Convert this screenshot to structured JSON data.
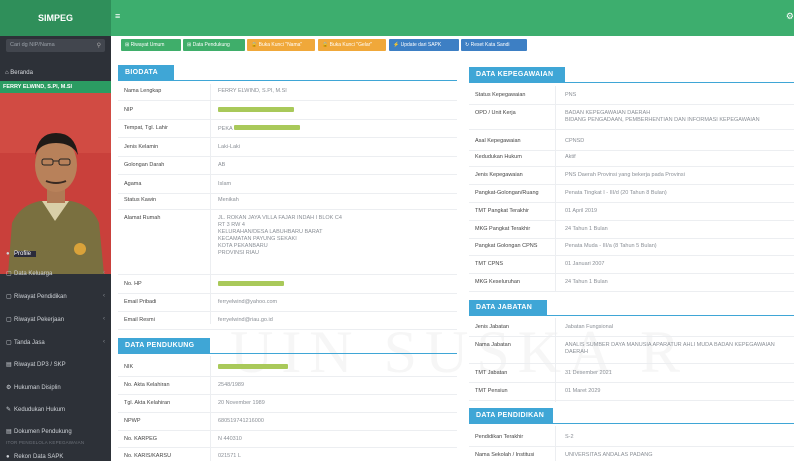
{
  "app": {
    "brand": "SIMPEG",
    "menu_icon": "≡",
    "top_right": "⚙"
  },
  "sidebar": {
    "search_placeholder": "Cari dg NIP/Nama",
    "home": "Beranda",
    "user_name": "FERRY ELWIND, S.PI, M.SI",
    "items": [
      {
        "label": "Profile",
        "icon": "●",
        "chevron": ""
      },
      {
        "label": "Data Keluarga",
        "icon": "▢",
        "chevron": "‹"
      },
      {
        "label": "Riwayat Pendidikan",
        "icon": "▢",
        "chevron": "‹"
      },
      {
        "label": "Riwayat Pekerjaan",
        "icon": "▢",
        "chevron": "‹"
      },
      {
        "label": "Tanda Jasa",
        "icon": "▢",
        "chevron": "‹"
      },
      {
        "label": "Riwayat DP3 / SKP",
        "icon": "▤",
        "chevron": ""
      },
      {
        "label": "Hukuman Disiplin",
        "icon": "⚙",
        "chevron": ""
      },
      {
        "label": "Kedudukan Hukum",
        "icon": "✎",
        "chevron": ""
      },
      {
        "label": "Dokumen Pendukung",
        "icon": "▤",
        "chevron": ""
      }
    ],
    "caption": "ITOR PENGELOLA KEPEGAWAIAN",
    "bottom_item": "Rekon Data SAPK"
  },
  "toolbar": {
    "b1": "⊞ Riwayat Umum",
    "b2": "⊞ Data Pendukung",
    "b3": "🔒 Buka Kunci \"Nama\"",
    "b4": "🔒 Buka Kunci \"Gelar\"",
    "b5": "⚡ Update dari SAPK",
    "b6": "↻ Reset Kata Sandi"
  },
  "biodata": {
    "title": "BIODATA",
    "rows": [
      {
        "label": "Nama Lengkap",
        "value": "FERRY ELWIND, S.PI, M.SI"
      },
      {
        "label": "NIP",
        "value": ""
      },
      {
        "label": "Tempat, Tgl. Lahir",
        "value": "PEKA"
      },
      {
        "label": "Jenis Kelamin",
        "value": "Laki-Laki"
      },
      {
        "label": "Golongan Darah",
        "value": "AB"
      },
      {
        "label": "Agama",
        "value": "Islam"
      },
      {
        "label": "Status Kawin",
        "value": "Menikah"
      }
    ],
    "alamat_label": "Alamat Rumah",
    "alamat_lines": [
      "JL. ROKAN JAYA VILLA FAJAR INDAH I BLOK C4",
      "RT 3 RW 4",
      "KELURAHAN/DESA LABUHBARU BARAT",
      "KECAMATAN PAYUNG SEKAKI",
      "KOTA PEKANBARU",
      "PROVINSI RIAU"
    ],
    "hp_label": "No. HP",
    "email_pribadi_label": "Email Pribadi",
    "email_pribadi": "ferryelwind@yahoo.com",
    "email_resmi_label": "Email Resmi",
    "email_resmi": "ferryelwind@riau.go.id"
  },
  "pendukung": {
    "title": "DATA PENDUKUNG",
    "rows": [
      {
        "label": "NIK",
        "value": ""
      },
      {
        "label": "No. Akta Kelahiran",
        "value": "2548/1989"
      },
      {
        "label": "Tgl. Akta Kelahiran",
        "value": "20 November 1989"
      },
      {
        "label": "NPWP",
        "value": "680519741216000"
      },
      {
        "label": "No. KARPEG",
        "value": "N 440310"
      },
      {
        "label": "No. KARIS/KARSU",
        "value": "021571 L"
      }
    ]
  },
  "kepegawaian": {
    "title": "DATA KEPEGAWAIAN",
    "rows": [
      {
        "label": "Status Kepegawaian",
        "value": "PNS",
        "value2": ""
      },
      {
        "label": "OPD / Unit Kerja",
        "value": "BADAN KEPEGAWAIAN DAERAH",
        "value2": "BIDANG PENGADAAN, PEMBERHENTIAN DAN INFORMASI KEPEGAWAIAN"
      },
      {
        "label": "Asal Kepegawaian",
        "value": "CPNSD",
        "value2": ""
      },
      {
        "label": "Kedudukan Hukum",
        "value": "Aktif",
        "value2": ""
      },
      {
        "label": "Jenis Kepegawaian",
        "value": "PNS Daerah Provinsi yang bekerja pada Provinsi",
        "value2": ""
      },
      {
        "label": "Pangkat-Golongan/Ruang",
        "value": "Penata Tingkat I - III/d (20 Tahun 8 Bulan)",
        "value2": ""
      },
      {
        "label": "TMT Pangkat Terakhir",
        "value": "01 April 2019",
        "value2": ""
      },
      {
        "label": "MKG Pangkat Terakhir",
        "value": "24 Tahun 1 Bulan",
        "value2": ""
      },
      {
        "label": "Pangkat Golongan CPNS",
        "value": "Penata Muda - III/a (8 Tahun 5 Bulan)",
        "value2": ""
      },
      {
        "label": "TMT CPNS",
        "value": "01 Januari 2007",
        "value2": ""
      },
      {
        "label": "MKG Keseluruhan",
        "value": "24 Tahun 1 Bulan",
        "value2": ""
      }
    ]
  },
  "jabatan": {
    "title": "DATA JABATAN",
    "rows": [
      {
        "label": "Jenis Jabatan",
        "value": "Jabatan Fungsional",
        "value2": ""
      },
      {
        "label": "Nama Jabatan",
        "value": "ANALIS SUMBER DAYA MANUSIA APARATUR AHLI MUDA BADAN KEPEGAWAIAN",
        "value2": "DAERAH"
      },
      {
        "label": "TMT Jabatan",
        "value": "31 Desember 2021",
        "value2": ""
      },
      {
        "label": "TMT Pensiun",
        "value": "01 Maret 2029",
        "value2": ""
      }
    ]
  },
  "pendidikan": {
    "title": "DATA PENDIDIKAN",
    "rows": [
      {
        "label": "Pendidikan Terakhir",
        "value": "S-2"
      },
      {
        "label": "Nama Sekolah / Institusi",
        "value": "UNIVERSITAS ANDALAS PADANG"
      }
    ]
  },
  "watermark": "UIN SUSKA R"
}
